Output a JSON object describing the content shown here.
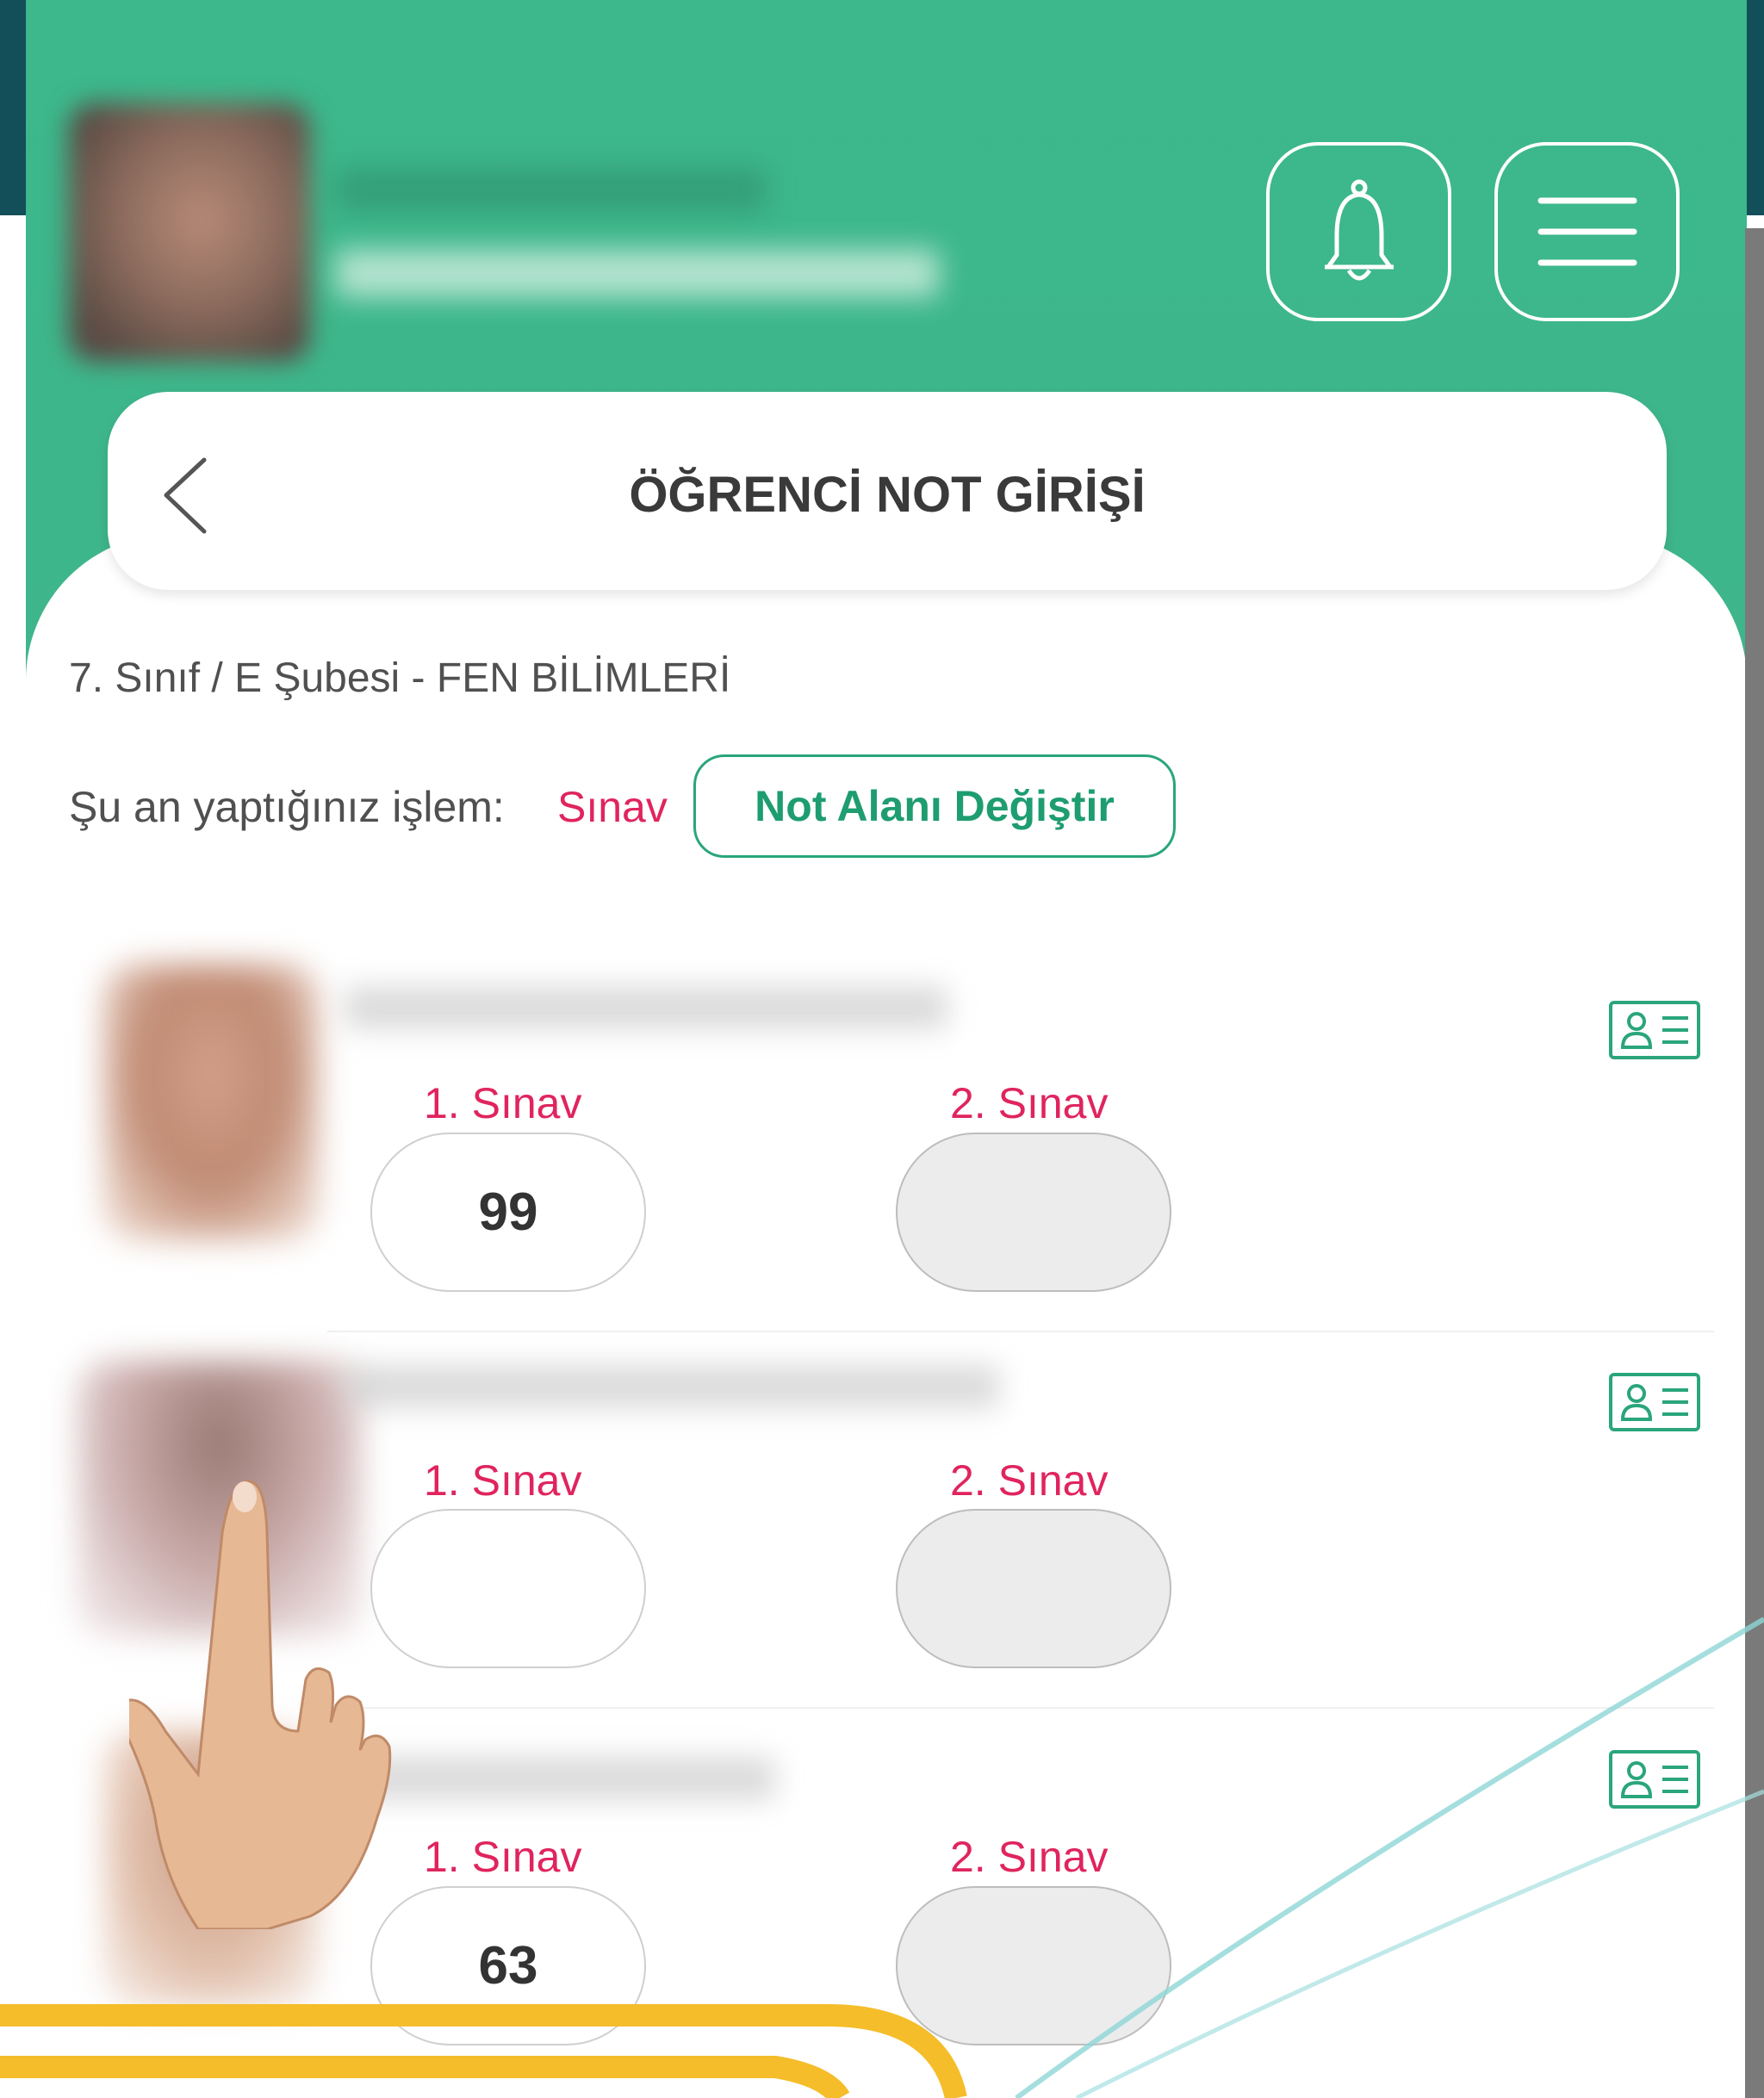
{
  "header": {
    "notifications_icon": "bell-icon",
    "menu_icon": "hamburger-menu-icon",
    "accent_color": "#3cb88c"
  },
  "page": {
    "title": "ÖĞRENCİ NOT GİRİŞİ",
    "back_icon": "chevron-left-icon"
  },
  "class_info": {
    "subtitle": "7. Sınıf / E Şubesi - FEN BİLİMLERİ",
    "operation_label": "Şu an yaptığınız işlem:",
    "operation_value": "Sınav",
    "change_button_label": "Not Alanı Değiştir"
  },
  "students": [
    {
      "exam_1_label": "1. Sınav",
      "exam_1_value": "99",
      "exam_2_label": "2. Sınav",
      "exam_2_value": "",
      "card_icon": "student-card-icon"
    },
    {
      "exam_1_label": "1. Sınav",
      "exam_1_value": "",
      "exam_2_label": "2. Sınav",
      "exam_2_value": "",
      "card_icon": "student-card-icon"
    },
    {
      "exam_1_label": "1. Sınav",
      "exam_1_value": "63",
      "exam_2_label": "2. Sınav",
      "exam_2_value": "",
      "card_icon": "student-card-icon"
    }
  ],
  "colors": {
    "label_pink": "#e0245e",
    "button_green": "#2aa57c",
    "frame_yellow": "#f5bd2a"
  }
}
